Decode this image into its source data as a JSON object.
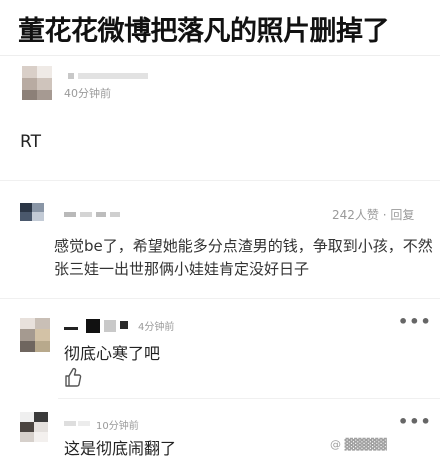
{
  "post": {
    "title": "董花花微博把落凡的照片删掉了",
    "author_time": "40分钟前",
    "body": "RT"
  },
  "comments": [
    {
      "meta": "242人赞 · 回复",
      "text": "感觉be了，希望她能多分点渣男的钱，争取到小孩，不然张三娃一出世那俩小娃娃肯定没好日子"
    },
    {
      "time": "4分钟前",
      "text": "彻底心寒了吧",
      "more": "•••"
    },
    {
      "time": "10分钟前",
      "text": "这是彻底闹翻了",
      "more": "•••"
    }
  ],
  "watermark": "@ ▓▓▓▓▓",
  "colors": {
    "muted": "#9a9a9a",
    "divider": "#f0f0f0",
    "title": "#111111"
  }
}
